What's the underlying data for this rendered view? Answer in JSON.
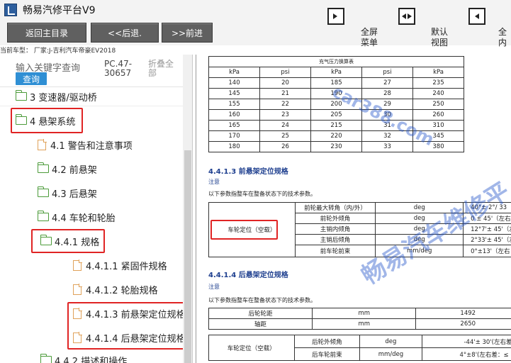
{
  "window": {
    "title": "畅易汽修平台V9"
  },
  "toolbar": {
    "home": "返回主目录",
    "back": "<<后退.",
    "forward": ">>前进",
    "fullscreen": [
      "全屏",
      "菜单"
    ],
    "default": [
      "默认",
      "视图"
    ],
    "full_content": [
      "全",
      "内"
    ]
  },
  "vehicle_line": "当前车型： 厂家:J-吉利汽车帝豪EV2018",
  "search": {
    "placeholder": "输入关键字查询",
    "button": "查询",
    "pc_info": "PC.47-30657",
    "collapse": "折叠全部"
  },
  "tree": [
    {
      "label": "3 变速器/驱动桥"
    },
    {
      "label": "4 悬架系统"
    },
    {
      "label": "4.1 警告和注意事项"
    },
    {
      "label": "4.2 前悬架"
    },
    {
      "label": "4.3 后悬架"
    },
    {
      "label": "4.4 车轮和轮胎"
    },
    {
      "label": "4.4.1 规格"
    },
    {
      "label": "4.4.1.1 紧固件规格"
    },
    {
      "label": "4.4.1.2 轮胎规格"
    },
    {
      "label": "4.4.1.3 前悬架定位规格"
    },
    {
      "label": "4.4.1.4 后悬架定位规格"
    },
    {
      "label": "4.4.2 描述和操作"
    }
  ],
  "doc": {
    "pressure_caption": "充气压力换算表",
    "pressure_headers": [
      "kPa",
      "psi",
      "kPa",
      "psi",
      "kPa"
    ],
    "pressure_rows": [
      [
        "140",
        "20",
        "185",
        "27",
        "235"
      ],
      [
        "145",
        "21",
        "190",
        "28",
        "240"
      ],
      [
        "155",
        "22",
        "200",
        "29",
        "250"
      ],
      [
        "160",
        "23",
        "205",
        "30",
        "260"
      ],
      [
        "165",
        "24",
        "215",
        "31",
        "310"
      ],
      [
        "170",
        "25",
        "220",
        "32",
        "345"
      ],
      [
        "180",
        "26",
        "230",
        "33",
        "380"
      ]
    ],
    "front_title": "4.4.1.3 前悬架定位规格",
    "note_label": "注意",
    "front_note": "以下参数指整车在整备状态下的技术参数。",
    "front_group": "车轮定位（空载）",
    "front_rows": [
      [
        "前轮最大转角（内/外）",
        "deg",
        "40°± 2°/ 33"
      ],
      [
        "前轮外倾角",
        "deg",
        "0 ± 45'（左右"
      ],
      [
        "主销内倾角",
        "deg",
        "12°7'± 45'（左"
      ],
      [
        "主销后倾角",
        "deg",
        "2°33'± 45'（左"
      ],
      [
        "前车轮前束",
        "mm/deg",
        "0°±13'（左右"
      ]
    ],
    "rear_title": "4.4.1.4 后悬架定位规格",
    "rear_note": "以下参数指整车在整备状态下的技术参数。",
    "rear_rows_top": [
      [
        "后轮轮距",
        "mm",
        "1492"
      ],
      [
        "轴距",
        "mm",
        "2650"
      ]
    ],
    "rear_group": "车轮定位（空载）",
    "rear_rows": [
      [
        "后轮外倾角",
        "deg",
        "-44'± 30'(左右差："
      ],
      [
        "后车轮前束",
        "mm/deg",
        "4°±8'(左右差：≤ 15"
      ]
    ]
  },
  "watermark": {
    "site": "car388.com",
    "brand": "畅易汽车维修平"
  }
}
